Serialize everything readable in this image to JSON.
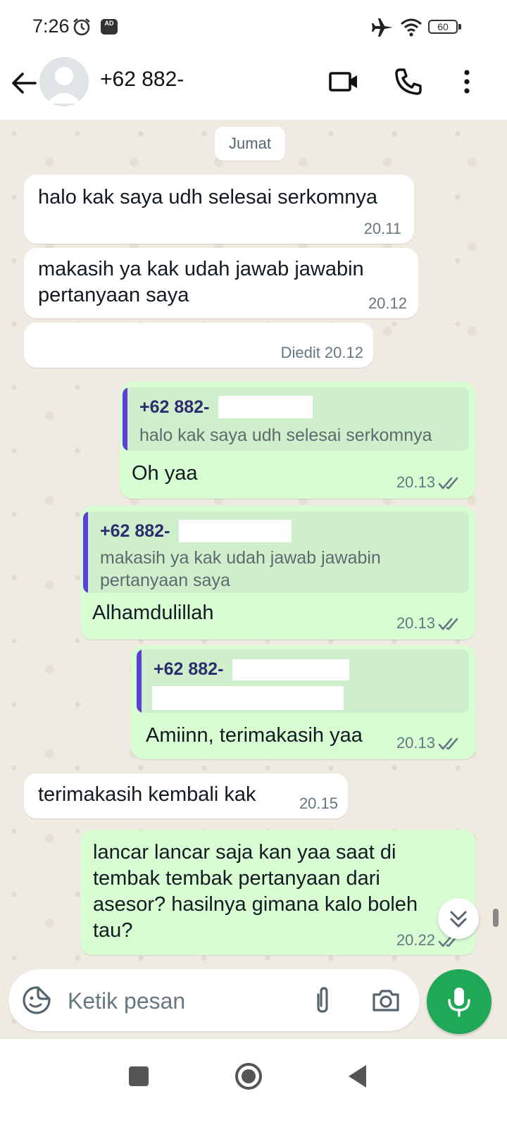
{
  "status_bar": {
    "time": "7:26",
    "ad_label": "AD",
    "battery": "60"
  },
  "header": {
    "contact": "+62 882-"
  },
  "chat": {
    "day": "Jumat",
    "messages": [
      {
        "text": "halo kak saya udh selesai serkomnya",
        "time": "20.11"
      },
      {
        "text": "makasih ya kak udah jawab jawabin pertanyaan saya",
        "time": "20.12"
      },
      {
        "text": "",
        "time": "Diedit 20.12"
      },
      {
        "quote_name": "+62 882-",
        "quote_text": "halo kak saya udh selesai serkomnya",
        "text": "Oh yaa",
        "time": "20.13"
      },
      {
        "quote_name": "+62 882-",
        "quote_text": "makasih ya kak udah jawab jawabin pertanyaan saya",
        "text": "Alhamdulillah",
        "time": "20.13"
      },
      {
        "quote_name": "+62 882-",
        "quote_text": "",
        "text": "Amiinn, terimakasih yaa",
        "time": "20.13"
      },
      {
        "text": "terimakasih kembali kak",
        "time": "20.15"
      },
      {
        "text": "lancar lancar saja kan yaa saat di tembak tembak pertanyaan dari asesor? hasilnya gimana kalo boleh tau?",
        "time": "20.22"
      }
    ]
  },
  "composer": {
    "placeholder": "Ketik pesan"
  },
  "colors": {
    "outgoing": "#d9fdd3",
    "incoming": "#ffffff",
    "accent": "#1fa855",
    "quote_bar": "#5b3fd6"
  },
  "icons": [
    "alarm-icon",
    "airplane-icon",
    "wifi-icon",
    "battery-icon",
    "back-arrow-icon",
    "video-call-icon",
    "phone-icon",
    "more-vert-icon",
    "double-check-icon",
    "scroll-down-icon",
    "sticker-icon",
    "attach-icon",
    "camera-icon",
    "mic-icon"
  ]
}
